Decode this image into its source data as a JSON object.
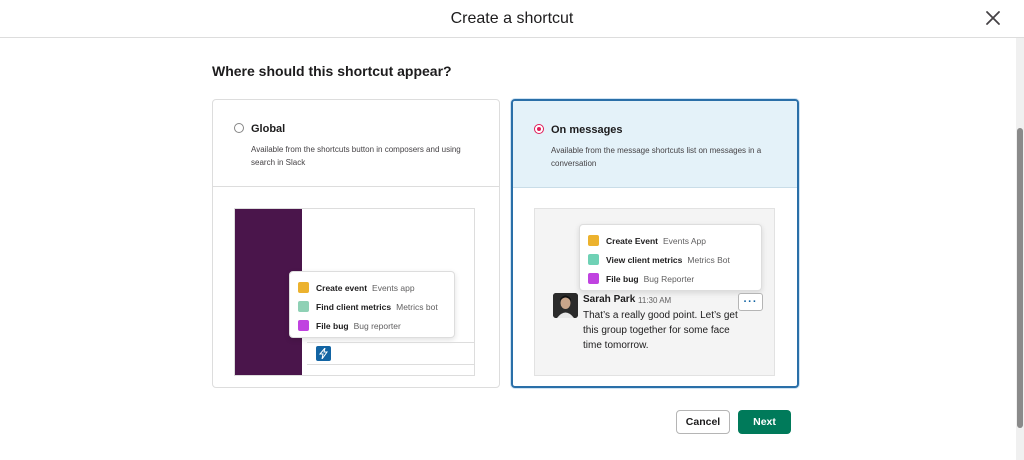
{
  "modal": {
    "title": "Create a shortcut",
    "close_icon": "close-icon"
  },
  "section": {
    "heading": "Where should this shortcut appear?"
  },
  "options": {
    "global": {
      "title": "Global",
      "description": "Available from the shortcuts button in composers and using search in Slack",
      "selected": false,
      "menu": [
        {
          "name": "Create event",
          "app": "Events app",
          "color": "#ecb22e"
        },
        {
          "name": "Find client metrics",
          "app": "Metrics bot",
          "color": "#8fd1b5"
        },
        {
          "name": "File bug",
          "app": "Bug reporter",
          "color": "#c043e0"
        }
      ],
      "composer_icon": "lightning-bolt-icon"
    },
    "messages": {
      "title": "On messages",
      "description": "Available from the message shortcuts list on messages in a conversation",
      "selected": true,
      "menu": [
        {
          "name": "Create Event",
          "app": "Events App",
          "color": "#ecb22e"
        },
        {
          "name": "View client metrics",
          "app": "Metrics Bot",
          "color": "#6fd1b5"
        },
        {
          "name": "File bug",
          "app": "Bug Reporter",
          "color": "#c043e0"
        }
      ],
      "message": {
        "author": "Sarah Park",
        "time": "11:30 AM",
        "text": "That’s a really good point. Let’s get this group together for some face time tomorrow.",
        "more_label": "···"
      }
    }
  },
  "footer": {
    "cancel_label": "Cancel",
    "next_label": "Next"
  },
  "colors": {
    "accent_selected": "#2a6fa8",
    "radio_selected": "#e01e5a",
    "primary_button": "#007a5a",
    "sidebar": "#4a154b"
  }
}
